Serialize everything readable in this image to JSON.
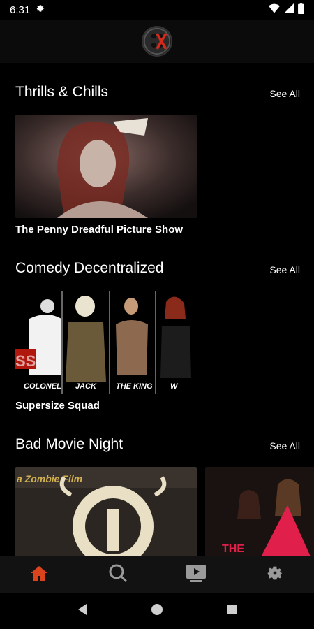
{
  "status_bar": {
    "time": "6:31",
    "icons": [
      "settings-icon",
      "wifi-icon",
      "signal-icon",
      "battery-icon"
    ]
  },
  "app_bar": {
    "logo_icon": "app-logo-icon"
  },
  "sections": [
    {
      "title": "Thrills & Chills",
      "see_all": "See All",
      "items": [
        {
          "title": "The Penny Dreadful Picture Show"
        }
      ]
    },
    {
      "title": "Comedy Decentralized",
      "see_all": "See All",
      "items": [
        {
          "title": "Supersize Squad",
          "poster_text": [
            "SS",
            "COLONEL",
            "JACK",
            "THE KING",
            "W"
          ]
        }
      ]
    },
    {
      "title": "Bad Movie Night",
      "see_all": "See All",
      "items": [
        {
          "title": "",
          "poster_text": "a Zombie Film"
        },
        {
          "title": "",
          "poster_text": "THE"
        }
      ]
    }
  ],
  "bottom_nav": {
    "items": [
      {
        "icon": "home-icon",
        "active": true
      },
      {
        "icon": "search-icon",
        "active": false
      },
      {
        "icon": "video-library-icon",
        "active": false
      },
      {
        "icon": "gear-icon",
        "active": false
      }
    ],
    "active_color": "#d9441c",
    "inactive_color": "#9a9a9a"
  },
  "system_nav": {
    "icons": [
      "back-icon",
      "home-circle-icon",
      "recents-icon"
    ]
  }
}
